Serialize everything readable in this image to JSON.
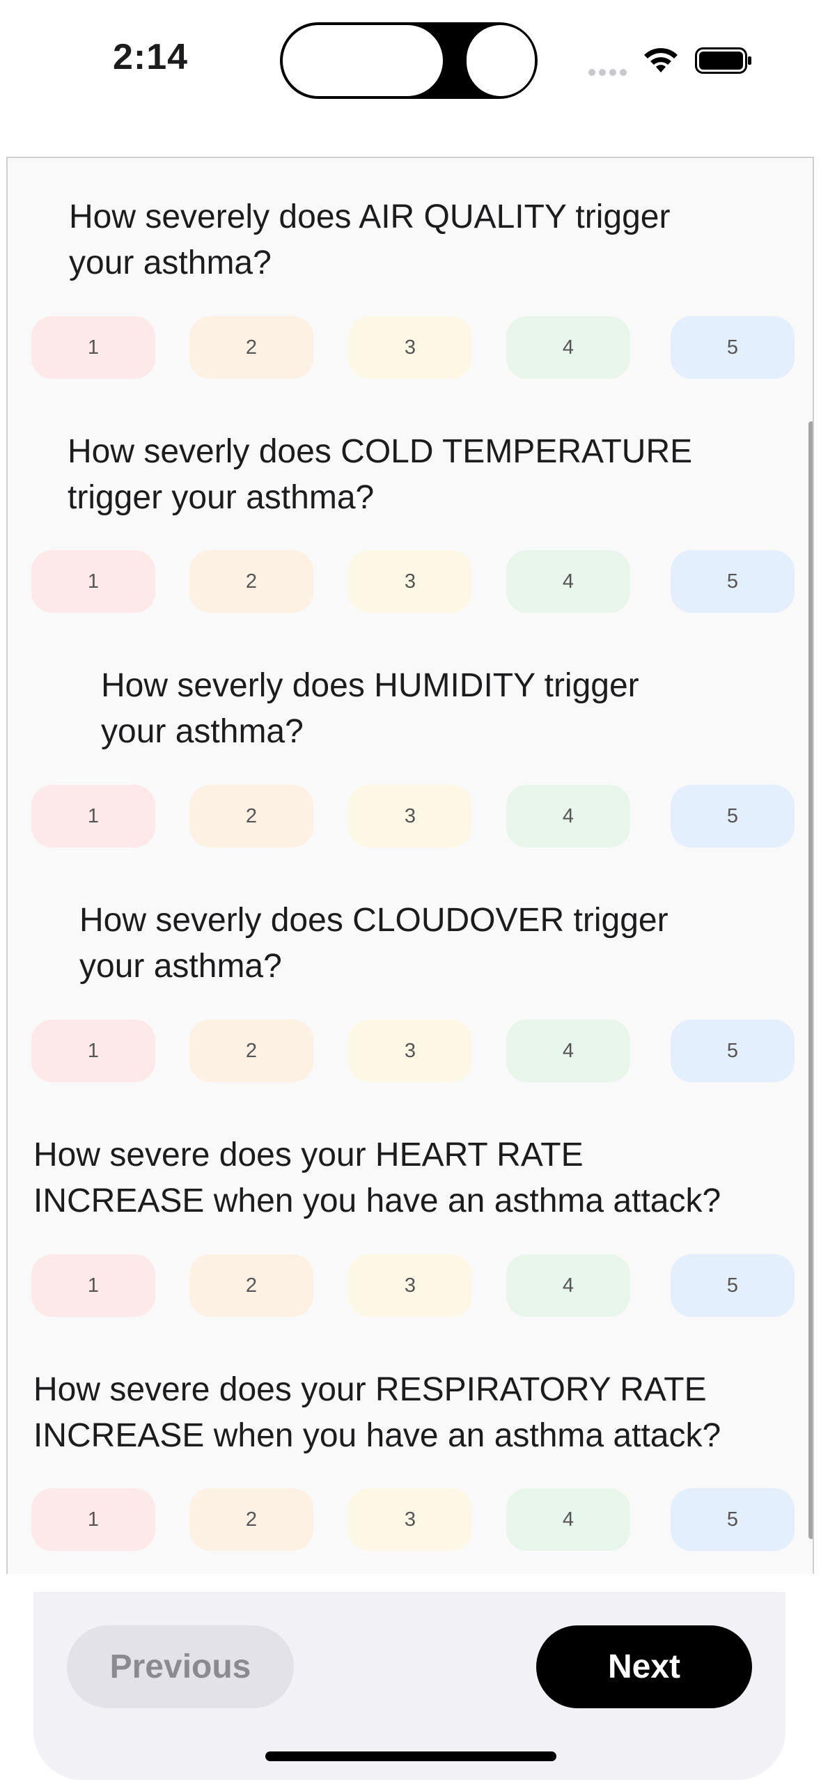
{
  "status_bar": {
    "time": "2:14"
  },
  "questions": [
    {
      "text_line1": "How severely does AIR QUALITY trigger",
      "text_line2": "your asthma?",
      "options": [
        "1",
        "2",
        "3",
        "4",
        "5"
      ]
    },
    {
      "text_line1": "How severly does COLD TEMPERATURE",
      "text_line2": "trigger your asthma?",
      "options": [
        "1",
        "2",
        "3",
        "4",
        "5"
      ]
    },
    {
      "text_line1": "How severly does HUMIDITY trigger",
      "text_line2": "your asthma?",
      "options": [
        "1",
        "2",
        "3",
        "4",
        "5"
      ]
    },
    {
      "text_line1": "How severly does CLOUDOVER trigger",
      "text_line2": "your asthma?",
      "options": [
        "1",
        "2",
        "3",
        "4",
        "5"
      ]
    },
    {
      "text_line1": "How severe does your HEART RATE",
      "text_line2": "INCREASE when you have an asthma attack?",
      "options": [
        "1",
        "2",
        "3",
        "4",
        "5"
      ]
    },
    {
      "text_line1": "How severe does your RESPIRATORY RATE",
      "text_line2": "INCREASE when you have an asthma attack?",
      "options": [
        "1",
        "2",
        "3",
        "4",
        "5"
      ]
    }
  ],
  "option_colors": [
    "#fde9ea",
    "#fdf1e4",
    "#fdf8e6",
    "#e8f5ea",
    "#e3effd"
  ],
  "nav": {
    "previous_label": "Previous",
    "next_label": "Next"
  },
  "icons": [
    "wifi-icon",
    "battery-icon",
    "cellular-signal-icon"
  ]
}
